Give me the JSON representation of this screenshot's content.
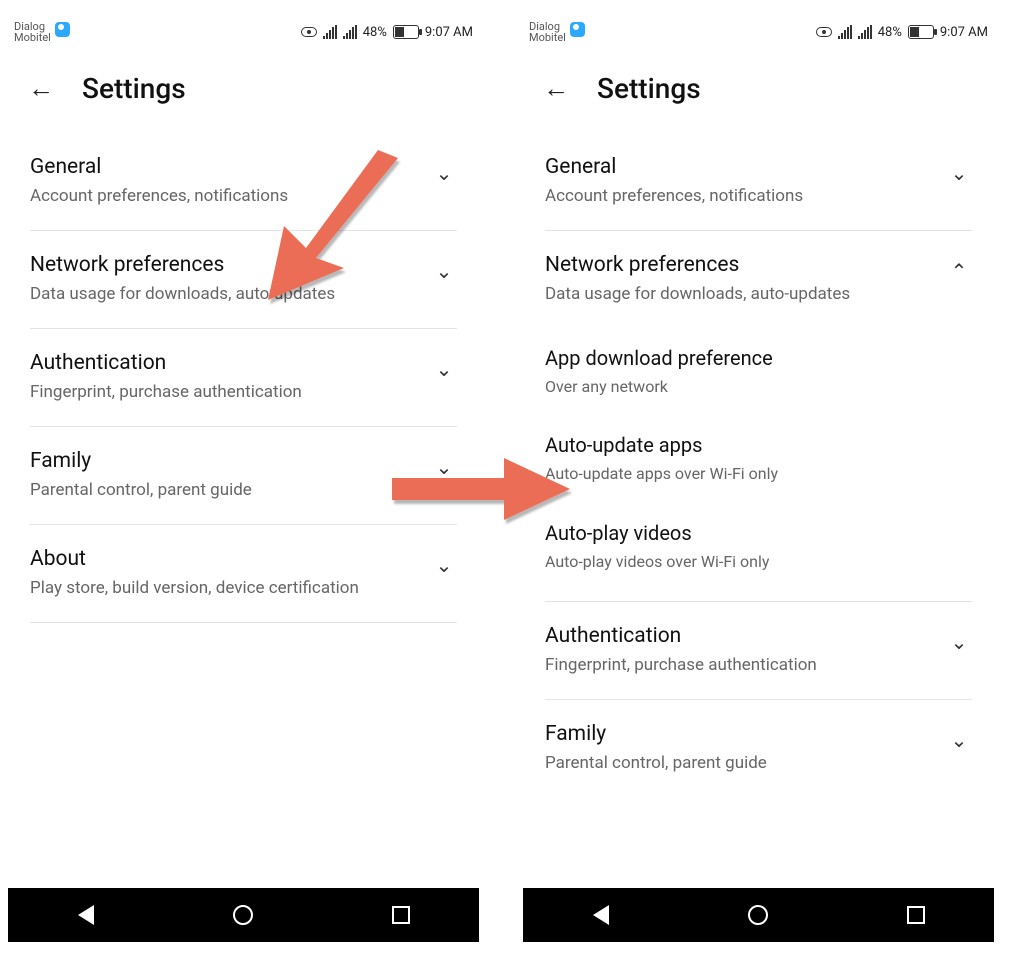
{
  "status": {
    "carrier1": "Dialog",
    "carrier2": "Mobitel",
    "battery": "48%",
    "time": "9:07 AM"
  },
  "header": {
    "title": "Settings"
  },
  "left": {
    "items": [
      {
        "title": "General",
        "sub": "Account preferences, notifications"
      },
      {
        "title": "Network preferences",
        "sub": "Data usage for downloads, auto-updates"
      },
      {
        "title": "Authentication",
        "sub": "Fingerprint, purchase authentication"
      },
      {
        "title": "Family",
        "sub": "Parental control, parent guide"
      },
      {
        "title": "About",
        "sub": "Play store, build version, device certification"
      }
    ]
  },
  "right": {
    "items": [
      {
        "title": "General",
        "sub": "Account preferences, notifications"
      },
      {
        "title": "Network preferences",
        "sub": "Data usage for downloads, auto-updates"
      }
    ],
    "subitems": [
      {
        "title": "App download preference",
        "sub": "Over any network"
      },
      {
        "title": "Auto-update apps",
        "sub": "Auto-update apps over Wi-Fi only"
      },
      {
        "title": "Auto-play videos",
        "sub": "Auto-play videos over Wi-Fi only"
      }
    ],
    "tail": [
      {
        "title": "Authentication",
        "sub": "Fingerprint, purchase authentication"
      },
      {
        "title": "Family",
        "sub": "Parental control, parent guide"
      }
    ]
  },
  "arrows": {
    "color": "#ec6d55"
  }
}
